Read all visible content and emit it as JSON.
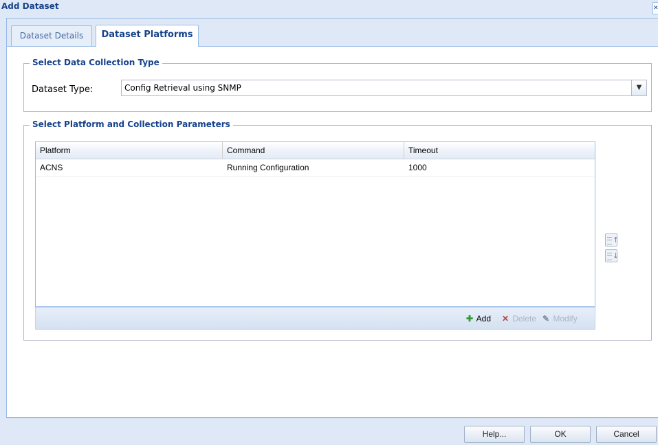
{
  "window": {
    "title": "Add Dataset"
  },
  "tabs": [
    {
      "label": "Dataset Details",
      "active": false
    },
    {
      "label": "Dataset Platforms",
      "active": true
    }
  ],
  "collection_type": {
    "legend": "Select Data Collection Type",
    "field_label": "Dataset Type:",
    "selected_value": "Config Retrieval using SNMP"
  },
  "platform_params": {
    "legend": "Select Platform and Collection Parameters",
    "columns": [
      "Platform",
      "Command",
      "Timeout"
    ],
    "rows": [
      [
        "ACNS",
        "Running Configuration",
        "1000"
      ]
    ],
    "toolbar": {
      "add": "Add",
      "delete": "Delete",
      "modify": "Modify"
    }
  },
  "footer": {
    "help": "Help...",
    "ok": "OK",
    "cancel": "Cancel"
  },
  "colors": {
    "accent": "#15428b",
    "border": "#99bbe8",
    "background": "#dfe8f6"
  },
  "icons": [
    "close-icon",
    "dropdown-arrow-icon",
    "add-icon",
    "delete-icon",
    "modify-icon",
    "move-up-icon",
    "move-down-icon"
  ]
}
